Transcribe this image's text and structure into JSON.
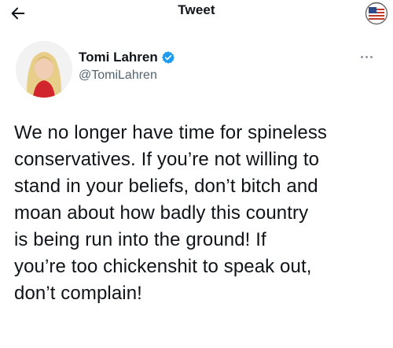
{
  "header": {
    "title": "Tweet",
    "back_icon": "arrow-left-icon",
    "logo_icon": "flag-badge-icon"
  },
  "author": {
    "display_name": "Tomi Lahren",
    "handle": "@TomiLahren",
    "verified_icon": "verified-badge-icon",
    "verified_color": "#1d9bf0"
  },
  "tweet": {
    "text": "We no longer have time for spineless\nconservatives. If you’re not willing to\nstand in your beliefs, don’t bitch and\nmoan about how badly this country\nis being run into the ground! If\nyou’re too chickenshit to speak out,\ndon’t complain!"
  }
}
